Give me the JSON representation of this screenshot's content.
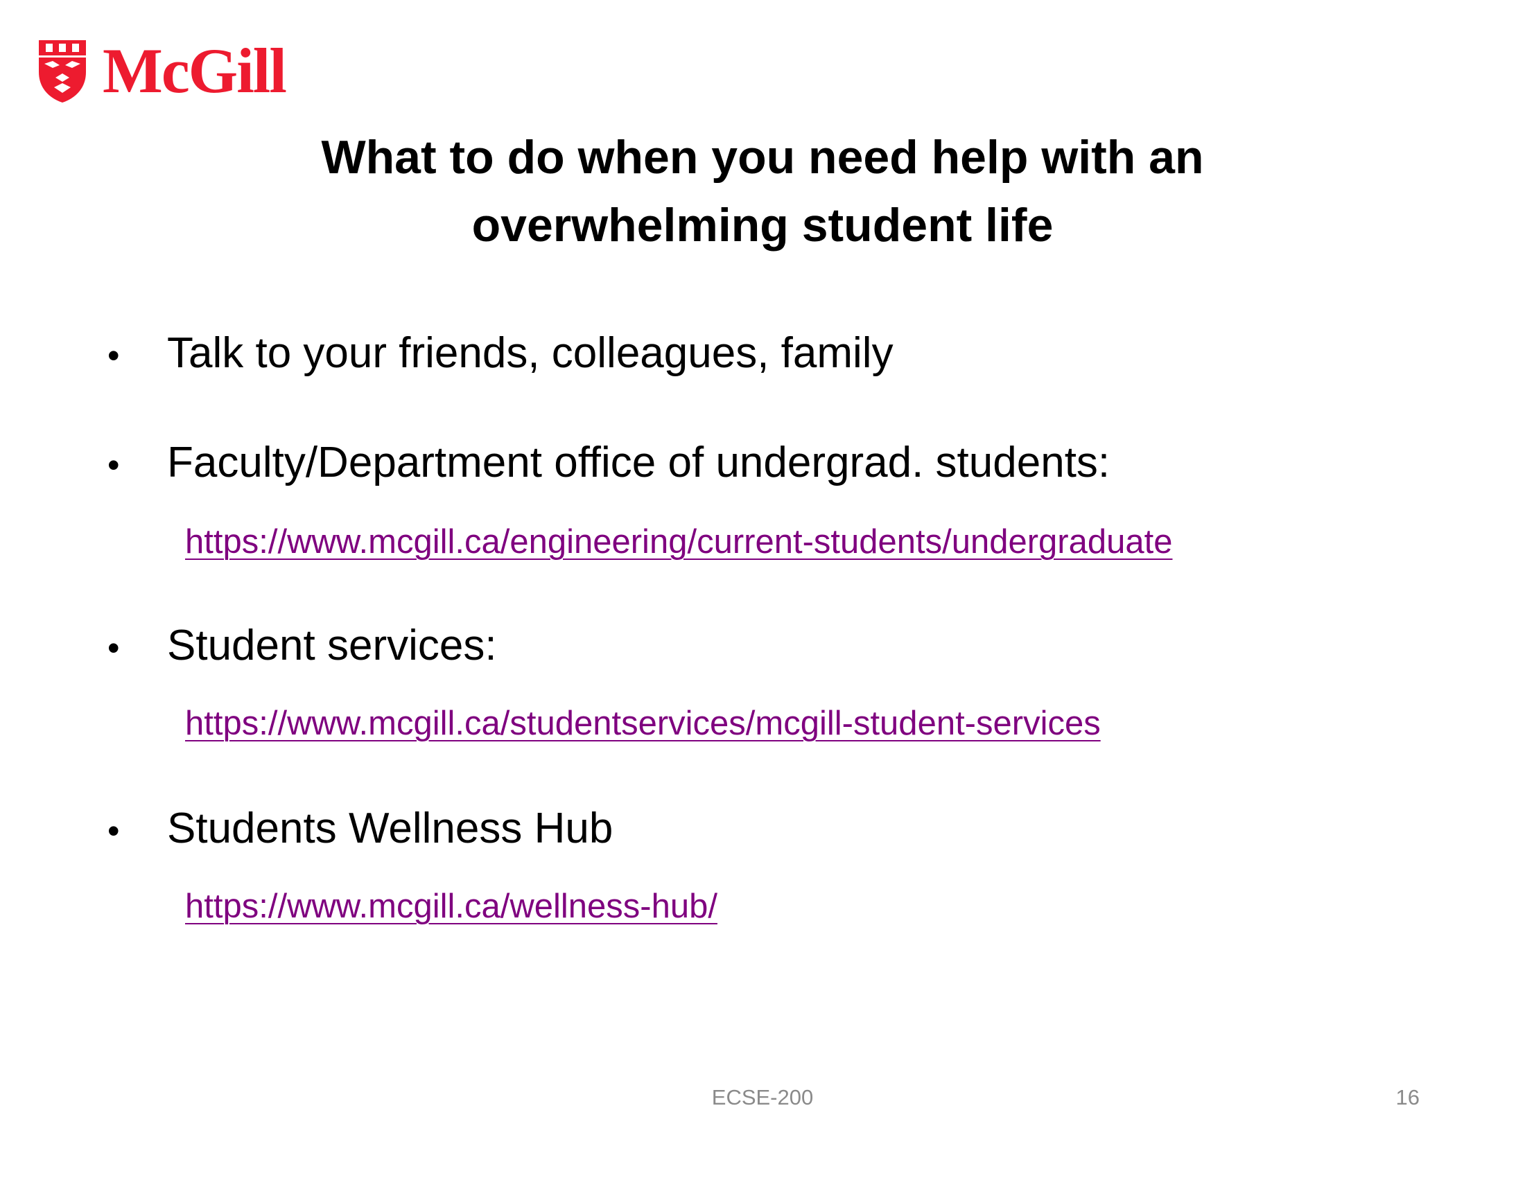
{
  "logo": {
    "wordmark": "McGill",
    "brand_color": "#ed1b2f",
    "icon": "mcgill-shield-icon"
  },
  "title": {
    "line1": "What to do when you need help with an",
    "line2": "overwhelming student life"
  },
  "bullets": [
    {
      "text": "Talk to your friends, colleagues, family"
    },
    {
      "text": "Faculty/Department office of undergrad. students:",
      "link": "https://www.mcgill.ca/engineering/current-students/undergraduate"
    },
    {
      "text": "Student services:",
      "link": "https://www.mcgill.ca/studentservices/mcgill-student-services"
    },
    {
      "text": "Students Wellness Hub",
      "link": "https://www.mcgill.ca/wellness-hub/"
    }
  ],
  "bullet_symbol": "•",
  "link_color": "#7f007f",
  "footer": {
    "course": "ECSE-200",
    "page_number": "16"
  }
}
